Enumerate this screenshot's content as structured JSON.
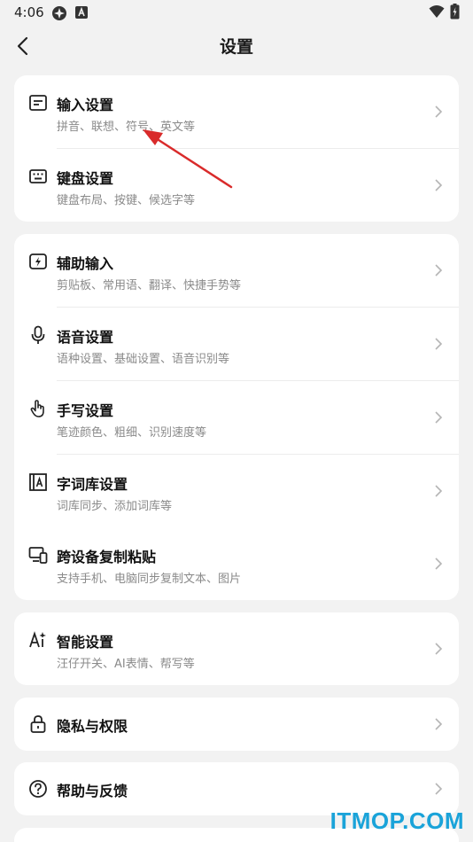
{
  "status_bar": {
    "time": "4:06"
  },
  "header": {
    "title": "设置"
  },
  "groups": [
    {
      "items": [
        {
          "label": "输入设置",
          "sub": "拼音、联想、符号、英文等",
          "icon": "input-settings-icon"
        },
        {
          "label": "键盘设置",
          "sub": "键盘布局、按键、候选字等",
          "icon": "keyboard-icon"
        }
      ]
    },
    {
      "items": [
        {
          "label": "辅助输入",
          "sub": "剪贴板、常用语、翻译、快捷手势等",
          "icon": "assist-input-icon"
        },
        {
          "label": "语音设置",
          "sub": "语种设置、基础设置、语音识别等",
          "icon": "microphone-icon"
        },
        {
          "label": "手写设置",
          "sub": "笔迹颜色、粗细、识别速度等",
          "icon": "handwriting-icon"
        },
        {
          "label": "字词库设置",
          "sub": "词库同步、添加词库等",
          "icon": "dictionary-icon"
        },
        {
          "label": "跨设备复制粘贴",
          "sub": "支持手机、电脑同步复制文本、图片",
          "icon": "cross-device-icon"
        }
      ]
    },
    {
      "items": [
        {
          "label": "智能设置",
          "sub": "汪仔开关、AI表情、帮写等",
          "icon": "ai-icon"
        }
      ]
    },
    {
      "items": [
        {
          "label": "隐私与权限",
          "icon": "lock-icon"
        }
      ]
    },
    {
      "items": [
        {
          "label": "帮助与反馈",
          "icon": "help-icon"
        }
      ]
    }
  ],
  "watermark": "ITMOP.COM"
}
